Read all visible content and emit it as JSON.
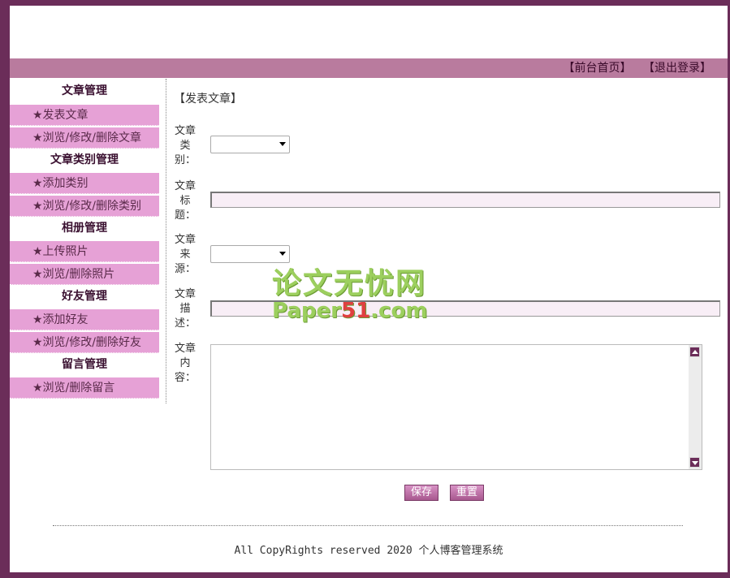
{
  "topbar": {
    "home_link": "【前台首页】",
    "logout_link": "【退出登录】"
  },
  "sidebar": {
    "sections": [
      {
        "title": "文章管理",
        "items": [
          "★发表文章",
          "★浏览/修改/删除文章"
        ]
      },
      {
        "title": "文章类别管理",
        "items": [
          "★添加类别",
          "★浏览/修改/删除类别"
        ]
      },
      {
        "title": "相册管理",
        "items": [
          "★上传照片",
          "★浏览/删除照片"
        ]
      },
      {
        "title": "好友管理",
        "items": [
          "★添加好友",
          "★浏览/修改/删除好友"
        ]
      },
      {
        "title": "留言管理",
        "items": [
          "★浏览/删除留言"
        ]
      }
    ]
  },
  "content": {
    "page_title": "【发表文章】",
    "labels": {
      "category": "文章类别：",
      "title": "文章标题：",
      "source": "文章来源：",
      "description": "文章描述：",
      "body": "文章内容："
    },
    "category_value": "",
    "source_value": "",
    "title_value": "",
    "description_value": "",
    "body_value": "",
    "save_label": "保存",
    "reset_label": "重置"
  },
  "watermark": {
    "line1": "论文无忧网",
    "line2a": "Paper",
    "line2b": "51",
    "line2c": ".com"
  },
  "footer": {
    "text": "All CopyRights reserved 2020 个人博客管理系统"
  }
}
